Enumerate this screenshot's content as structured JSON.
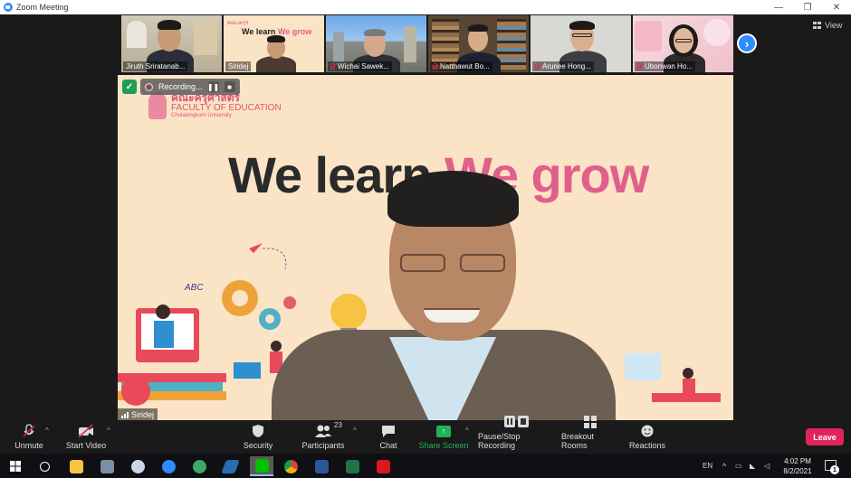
{
  "window": {
    "title": "Zoom Meeting",
    "minimize": "—",
    "restore": "❐",
    "close": "✕"
  },
  "participants_strip": [
    {
      "name": "Jiruth Sriratanab...",
      "muted": false
    },
    {
      "name": "Siridej",
      "muted": false
    },
    {
      "name": "Wichai Sawek...",
      "muted": true
    },
    {
      "name": "Natthawut Bo...",
      "muted": true
    },
    {
      "name": "Arunee Hong...",
      "muted": true
    },
    {
      "name": "Ubonwan Ho...",
      "muted": true
    }
  ],
  "thumb_slide": {
    "title_a": "We learn",
    "title_b": "We grow",
    "logo": "คณะครุฯ"
  },
  "next_arrow": "›",
  "view_label": "View",
  "recording": {
    "label": "Recording...",
    "pause": "❚❚",
    "stop": "■"
  },
  "main": {
    "logo_thai": "คณะครุศาสตร์",
    "logo_en": "FACULTY OF EDUCATION",
    "logo_sub": "Chulalongkorn University",
    "title_a": "We learn",
    "title_b": "We grow",
    "speaker": "Siridej"
  },
  "toolbar": {
    "unmute": "Unmute",
    "start_video": "Start Video",
    "security": "Security",
    "participants": "Participants",
    "participants_count": "23",
    "chat": "Chat",
    "share_screen": "Share Screen",
    "pause_stop": "Pause/Stop Recording",
    "breakout": "Breakout Rooms",
    "reactions": "Reactions",
    "leave": "Leave"
  },
  "taskbar": {
    "lang": "EN",
    "time": "4:02 PM",
    "date": "8/2/2021",
    "notifications": "1"
  },
  "colors": {
    "accent": "#2d8cff",
    "leave": "#e0245e",
    "share": "#1fb355",
    "slide_bg": "#fbe3c5",
    "slide_pink": "#e0608b"
  }
}
